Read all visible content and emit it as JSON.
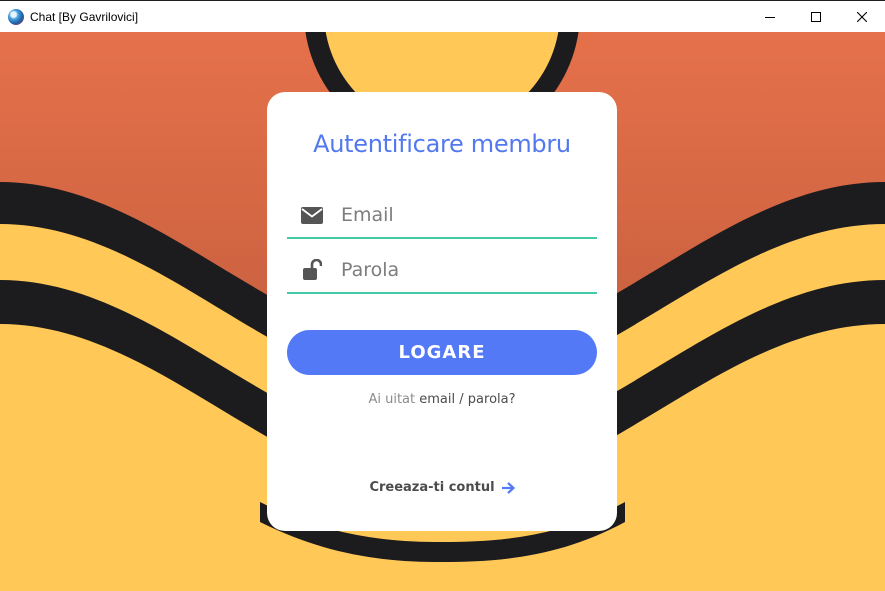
{
  "window": {
    "title": "Chat [By Gavrilovici]",
    "controls": [
      "minimize",
      "maximize",
      "close"
    ]
  },
  "colors": {
    "accent": "#5479f7",
    "underline": "#43c9a6",
    "background_top": "#e5714b",
    "background_yellow": "#ffc857",
    "stripe": "#1c1c1f"
  },
  "login": {
    "heading": "Autentificare membru",
    "email": {
      "placeholder": "Email",
      "icon": "envelope-icon"
    },
    "password": {
      "placeholder": "Parola",
      "icon": "unlock-icon"
    },
    "submit_label": "LOGARE",
    "forgot": {
      "prefix": "Ai uitat",
      "email_link": "email",
      "separator": "/",
      "password_link": "parola?"
    },
    "create_account": {
      "label": "Creeaza-ti contul",
      "icon": "arrow-right-icon"
    }
  }
}
